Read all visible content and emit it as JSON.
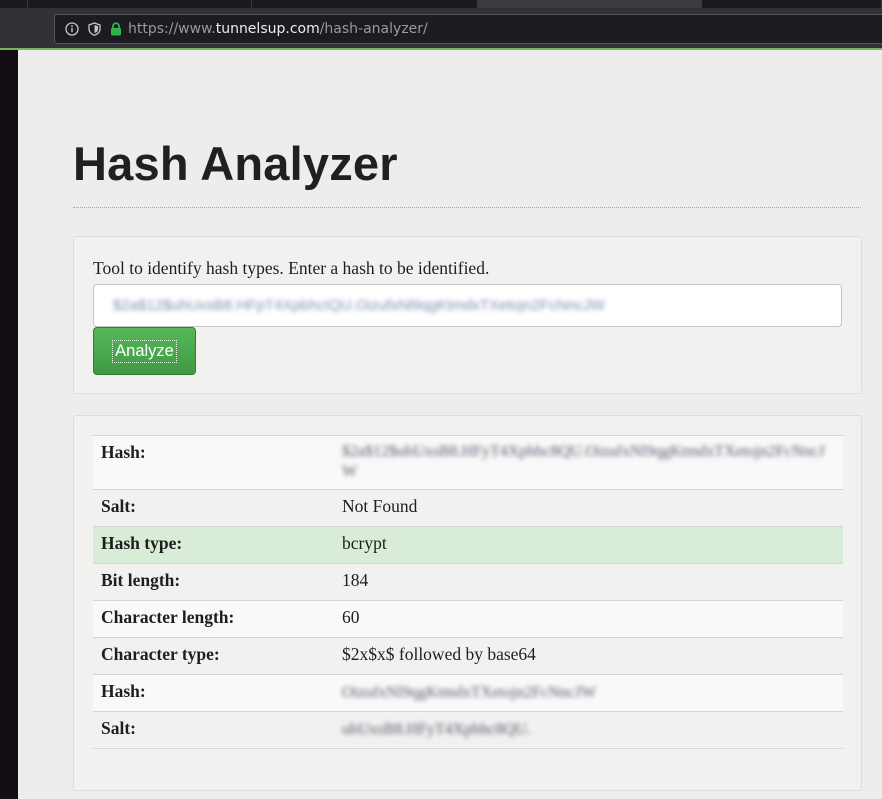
{
  "browser": {
    "url_prefix": "https://www.",
    "url_host": "tunnelsup.com",
    "url_path": "/hash-analyzer/",
    "icons": [
      "info-icon",
      "shield-icon",
      "lock-icon"
    ]
  },
  "page": {
    "title": "Hash Analyzer",
    "form": {
      "help_text": "Tool to identify hash types. Enter a hash to be identified.",
      "input_value": "$2a$12$uhUxsB8.HFpT4XpbhcIQU.OizufxNl9qgKtmdxTXetojn2FcNncJW",
      "submit_label": "Analyze"
    },
    "results": [
      {
        "label": "Hash:",
        "value": "$2a$12$ubUxsB8.HFyT4Xpbhc8QU.OizufxNl9qgKtmdxTXetojn2FcNncJW",
        "blurred": true
      },
      {
        "label": "Salt:",
        "value": "Not Found",
        "blurred": false
      },
      {
        "label": "Hash type:",
        "value": "bcrypt",
        "blurred": false
      },
      {
        "label": "Bit length:",
        "value": "184",
        "blurred": false
      },
      {
        "label": "Character length:",
        "value": "60",
        "blurred": false
      },
      {
        "label": "Character type:",
        "value": "$2x$x$ followed by base64",
        "blurred": false
      },
      {
        "label": "Hash:",
        "value": "OizufxNl9qgKtmdxTXetojn2FcNncJW",
        "blurred": true
      },
      {
        "label": "Salt:",
        "value": "ubUxsB8.HFyT4Xpbhc8QU.",
        "blurred": true
      }
    ]
  },
  "colors": {
    "accent_green": "#4cae50",
    "highlight_row": "#d9ecd7",
    "url_secure_lock": "#2fb24b"
  }
}
